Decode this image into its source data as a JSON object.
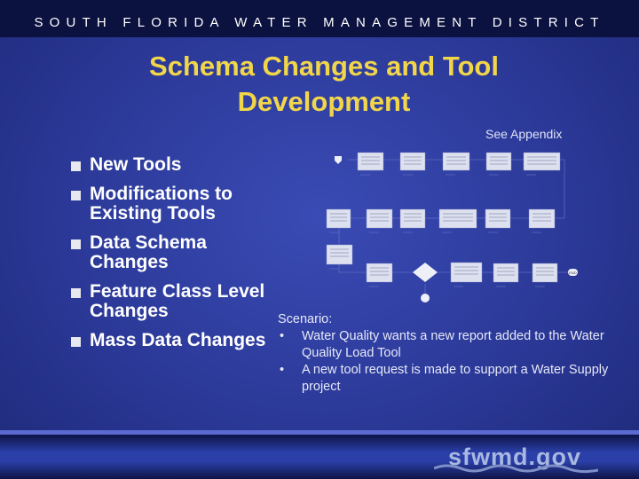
{
  "header": {
    "org_name": "SOUTH FLORIDA WATER MANAGEMENT DISTRICT"
  },
  "title": "Schema Changes and Tool Development",
  "appendix_note": "See Appendix",
  "bullets": [
    "New Tools",
    "Modifications to Existing Tools",
    "Data Schema Changes",
    "Feature Class Level Changes",
    "Mass Data Changes"
  ],
  "bullet_icon": "square-bullet",
  "diagram": {
    "start_label": "",
    "end_label": "END"
  },
  "scenario": {
    "label": "Scenario:",
    "items": [
      "Water Quality wants a new report added to the Water Quality Load Tool",
      "A new tool request is made to support a Water Supply project"
    ]
  },
  "footer": {
    "logo_text": "sfwmd.gov"
  },
  "colors": {
    "title": "#f2d64a",
    "header_bg": "#0c1240",
    "background": "#2c3a9c"
  }
}
